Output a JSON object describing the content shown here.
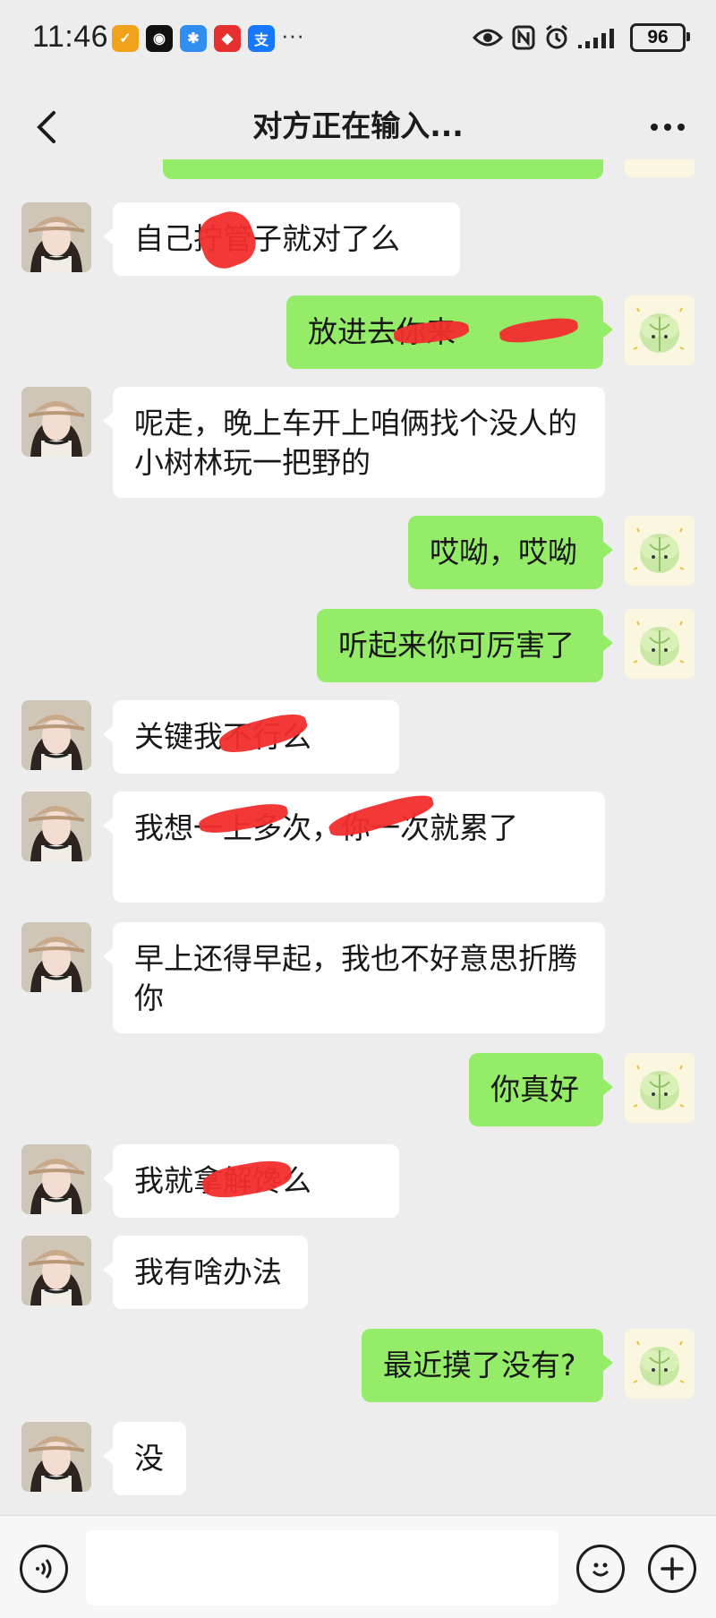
{
  "status_bar": {
    "time": "11:46",
    "more": "···",
    "battery": "96",
    "app_icons": [
      {
        "name": "app-icon-1",
        "glyph": "✓",
        "color": "#f0a21a"
      },
      {
        "name": "app-icon-2",
        "glyph": "◉",
        "color": "#111111"
      },
      {
        "name": "app-icon-3",
        "glyph": "✱",
        "color": "#2f8ef0"
      },
      {
        "name": "app-icon-4",
        "glyph": "◆",
        "color": "#e63030"
      },
      {
        "name": "app-icon-5",
        "glyph": "支",
        "color": "#1677ff"
      }
    ]
  },
  "nav": {
    "title": "对方正在输入..."
  },
  "messages": [
    {
      "side": "left",
      "text": "自己拧管子就对了么"
    },
    {
      "side": "right",
      "text": "放进去你来"
    },
    {
      "side": "left",
      "text": "呢走，晚上车开上咱俩找个没人的小树林玩一把野的"
    },
    {
      "side": "right",
      "text": "哎呦，哎呦"
    },
    {
      "side": "right",
      "text": "听起来你可厉害了"
    },
    {
      "side": "left",
      "text": "关键我不行么"
    },
    {
      "side": "left",
      "text": "我想一上多次，你一次就累了"
    },
    {
      "side": "left",
      "text": "早上还得早起，我也不好意思折腾你"
    },
    {
      "side": "right",
      "text": "你真好"
    },
    {
      "side": "left",
      "text": "我就拿解馋么"
    },
    {
      "side": "left",
      "text": "我有啥办法"
    },
    {
      "side": "right",
      "text": "最近摸了没有?"
    },
    {
      "side": "left",
      "text": "没"
    }
  ],
  "input": {
    "placeholder": ""
  },
  "colors": {
    "right_bubble": "#95ec69",
    "left_bubble": "#ffffff",
    "background": "#ededed",
    "redaction": "#f22d2d"
  }
}
